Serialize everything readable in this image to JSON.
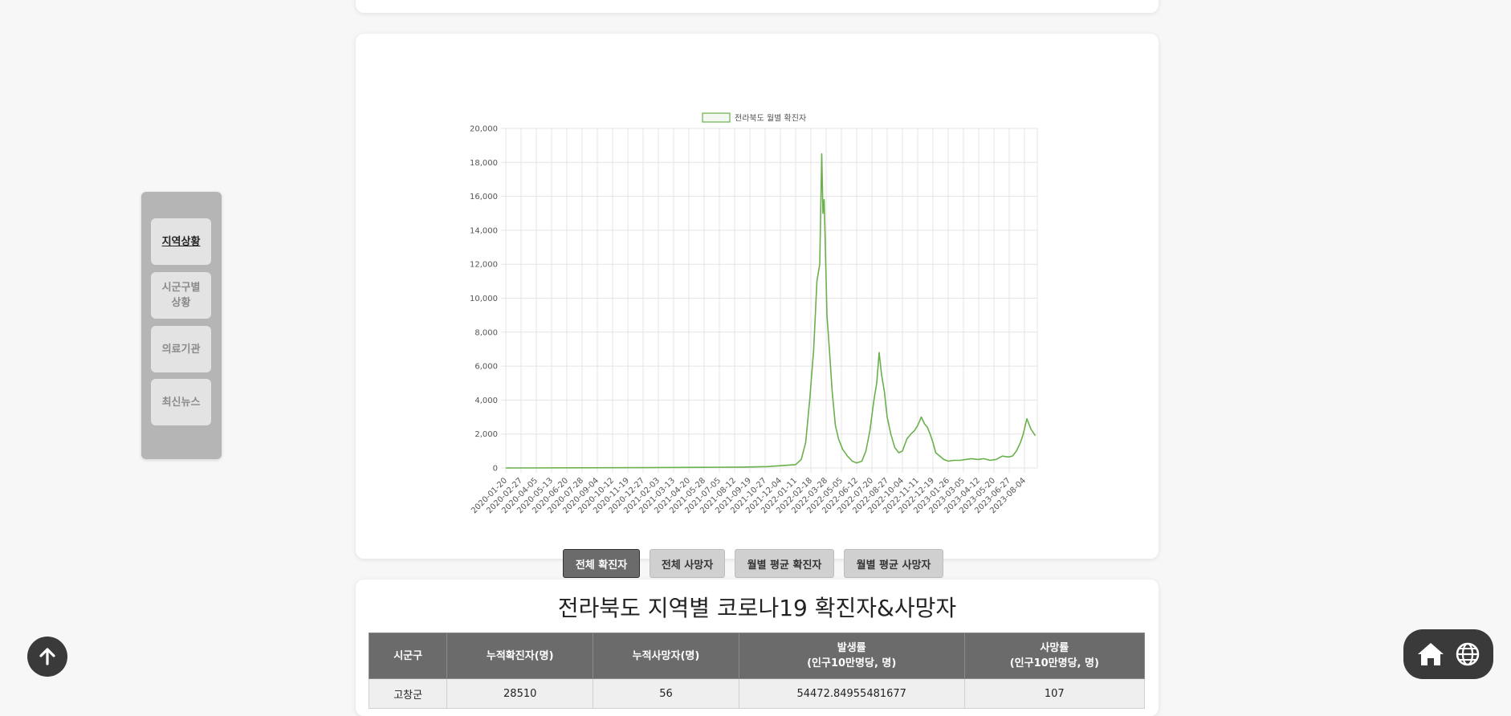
{
  "sidebar": {
    "items": [
      {
        "label": "지역상황",
        "active": true
      },
      {
        "label": "시군구별\n상황",
        "active": false
      },
      {
        "label": "의료기관",
        "active": false
      },
      {
        "label": "최신뉴스",
        "active": false
      }
    ]
  },
  "chart_buttons": [
    {
      "label": "전체 확진자",
      "active": true
    },
    {
      "label": "전체 사망자",
      "active": false
    },
    {
      "label": "월별 평균 확진자",
      "active": false
    },
    {
      "label": "월별 평균 사망자",
      "active": false
    }
  ],
  "chart_data": {
    "type": "line",
    "legend": "전라북도 월별 확진자",
    "legend_position": "top",
    "color": "#6ab04c",
    "grid": true,
    "ylim": [
      0,
      20000
    ],
    "y_ticks": [
      "20,000",
      "18,000",
      "16,000",
      "14,000",
      "12,000",
      "10,000",
      "8,000",
      "6,000",
      "4,000",
      "2,000",
      "0"
    ],
    "x_ticks": [
      "2020-01-20",
      "2020-02-27",
      "2020-04-05",
      "2020-05-13",
      "2020-06-20",
      "2020-07-28",
      "2020-09-04",
      "2020-10-12",
      "2020-11-19",
      "2020-12-27",
      "2021-02-03",
      "2021-03-13",
      "2021-04-20",
      "2021-05-28",
      "2021-07-05",
      "2021-08-12",
      "2021-09-19",
      "2021-10-27",
      "2021-12-04",
      "2022-01-11",
      "2022-02-18",
      "2022-03-28",
      "2022-05-05",
      "2022-06-12",
      "2022-07-20",
      "2022-08-27",
      "2022-10-04",
      "2022-11-11",
      "2022-12-19",
      "2023-01-26",
      "2023-03-05",
      "2023-04-12",
      "2023-05-20",
      "2023-06-27",
      "2023-08-04"
    ],
    "series": [
      {
        "name": "전라북도 월별 확진자",
        "x": [
          "2020-01-20",
          "2021-01-01",
          "2021-06-01",
          "2021-09-01",
          "2021-11-01",
          "2021-12-15",
          "2022-01-11",
          "2022-01-25",
          "2022-02-05",
          "2022-02-15",
          "2022-02-25",
          "2022-03-05",
          "2022-03-12",
          "2022-03-17",
          "2022-03-20",
          "2022-03-23",
          "2022-03-26",
          "2022-03-30",
          "2022-04-05",
          "2022-04-12",
          "2022-04-20",
          "2022-04-28",
          "2022-05-08",
          "2022-05-20",
          "2022-06-01",
          "2022-06-12",
          "2022-06-25",
          "2022-07-05",
          "2022-07-15",
          "2022-07-25",
          "2022-08-01",
          "2022-08-07",
          "2022-08-13",
          "2022-08-20",
          "2022-08-27",
          "2022-09-05",
          "2022-09-15",
          "2022-09-25",
          "2022-10-04",
          "2022-10-15",
          "2022-10-25",
          "2022-11-03",
          "2022-11-11",
          "2022-11-20",
          "2022-11-28",
          "2022-12-05",
          "2022-12-12",
          "2022-12-19",
          "2022-12-26",
          "2023-01-05",
          "2023-01-15",
          "2023-01-26",
          "2023-02-10",
          "2023-02-25",
          "2023-03-10",
          "2023-03-25",
          "2023-04-10",
          "2023-04-25",
          "2023-05-10",
          "2023-05-25",
          "2023-06-10",
          "2023-06-25",
          "2023-07-05",
          "2023-07-15",
          "2023-07-25",
          "2023-08-01",
          "2023-08-10",
          "2023-08-20",
          "2023-08-31"
        ],
        "y": [
          0,
          20,
          40,
          50,
          80,
          150,
          200,
          500,
          1500,
          4000,
          7000,
          11000,
          12000,
          18500,
          15000,
          15800,
          13000,
          9000,
          7000,
          4500,
          2500,
          1700,
          1100,
          700,
          400,
          300,
          400,
          1000,
          2200,
          4000,
          5000,
          6800,
          5500,
          4500,
          3000,
          2000,
          1200,
          900,
          1000,
          1700,
          2000,
          2200,
          2500,
          3000,
          2600,
          2400,
          2000,
          1500,
          900,
          700,
          500,
          400,
          450,
          450,
          500,
          550,
          500,
          550,
          450,
          500,
          700,
          650,
          700,
          1000,
          1500,
          2000,
          2900,
          2300,
          1900
        ]
      }
    ]
  },
  "table": {
    "title": "전라북도 지역별 코로나19 확진자&사망자",
    "headers": [
      "시군구",
      "누적확진자(명)",
      "누적사망자(명)",
      "발생률\n(인구10만명당, 명)",
      "사망률\n(인구10만명당, 명)"
    ],
    "rows": [
      [
        "고창군",
        "28510",
        "56",
        "54472.84955481677",
        "107"
      ]
    ]
  },
  "icons": {
    "top": "arrow-up-icon",
    "home": "home-icon",
    "globe": "globe-icon"
  }
}
